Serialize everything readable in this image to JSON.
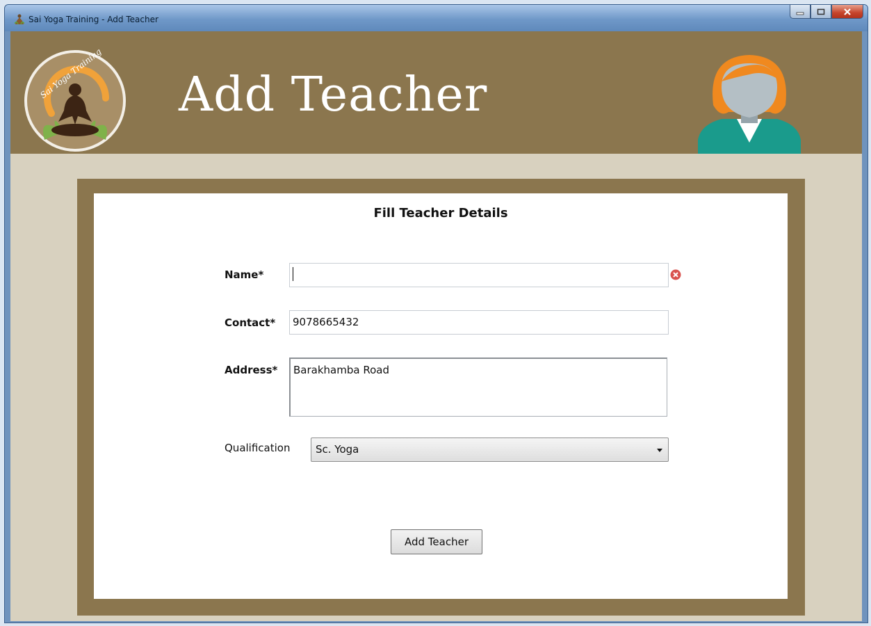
{
  "window": {
    "title": "Sai Yoga Training - Add Teacher"
  },
  "header": {
    "title": "Add Teacher",
    "logo_text": "Sai Yoga Training"
  },
  "form": {
    "heading": "Fill Teacher Details",
    "name": {
      "label": "Name*",
      "value": ""
    },
    "contact": {
      "label": "Contact*",
      "value": "9078665432"
    },
    "address": {
      "label": "Address*",
      "value": "Barakhamba Road"
    },
    "qualification": {
      "label": "Qualification",
      "selected": "Sc. Yoga"
    },
    "submit_label": "Add Teacher"
  },
  "icons": {
    "app": "meditation-icon",
    "validation": "error-icon",
    "avatar": "teacher-avatar-icon"
  },
  "colors": {
    "header_bg": "#8b764e",
    "client_bg": "#d8d1bf",
    "error": "#d9534f",
    "avatar_hair": "#f0891f",
    "avatar_shirt": "#1a9b8c"
  }
}
